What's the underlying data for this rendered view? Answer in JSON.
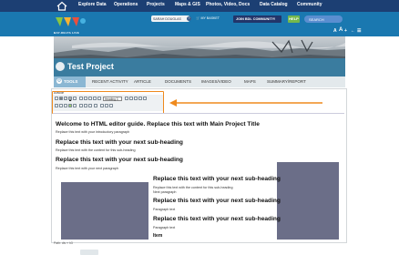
{
  "topnav": {
    "items": [
      {
        "label": "Explore Data"
      },
      {
        "label": "Operations"
      },
      {
        "label": "Projects"
      },
      {
        "label": "Maps & GIS"
      },
      {
        "label": "Photos, Video, Docs"
      },
      {
        "label": "Data Catalog"
      },
      {
        "label": "Community"
      }
    ]
  },
  "header": {
    "logo_text": "BAY-DELTA LIVE",
    "welcome": "SARAH DOUGLAS",
    "basket": "🛒 MY BASKET",
    "join": "JOIN BDL COMMUNITY!",
    "help": "HELP",
    "search_placeholder": "SEARCH",
    "a11y": [
      "A",
      "A",
      "+",
      "←",
      "☰"
    ]
  },
  "project": {
    "title": "Test Project"
  },
  "tabs": {
    "active": "TOOLS",
    "items": [
      "RECENT ACTIVITY",
      "ARTICLE",
      "DOCUMENTS",
      "IMAGES/VIDEO",
      "MAPS",
      "SUMMARY/REPORT"
    ]
  },
  "editor": {
    "label": "Article",
    "format_select": "Heading 3",
    "path": "Path: div » h3"
  },
  "content": {
    "main_heading": "Welcome to HTML editor guide. Replace this text with Main Project Title",
    "intro": "Replace this text with your introductory paragraph",
    "sub1": "Replace this text with your next sub-heading",
    "p1": "Replace this text with the content for this sub-heading",
    "sub2": "Replace this text with your next sub-heading",
    "p2": "Replace this text with your next paragraph",
    "sub3": "Replace this text with your next sub-heading",
    "p3a": "Replace this text with the content for this sub-heading",
    "p3b": "Next paragraph",
    "sub4": "Replace this text with your next sub-heading",
    "p4": "Paragraph text",
    "sub5": "Replace this text with your next sub-heading",
    "p5": "Paragraph text",
    "item": "Item"
  },
  "colors": {
    "accent": "#ef8a1d",
    "nav": "#1c3f73",
    "header": "#1a78b0"
  }
}
